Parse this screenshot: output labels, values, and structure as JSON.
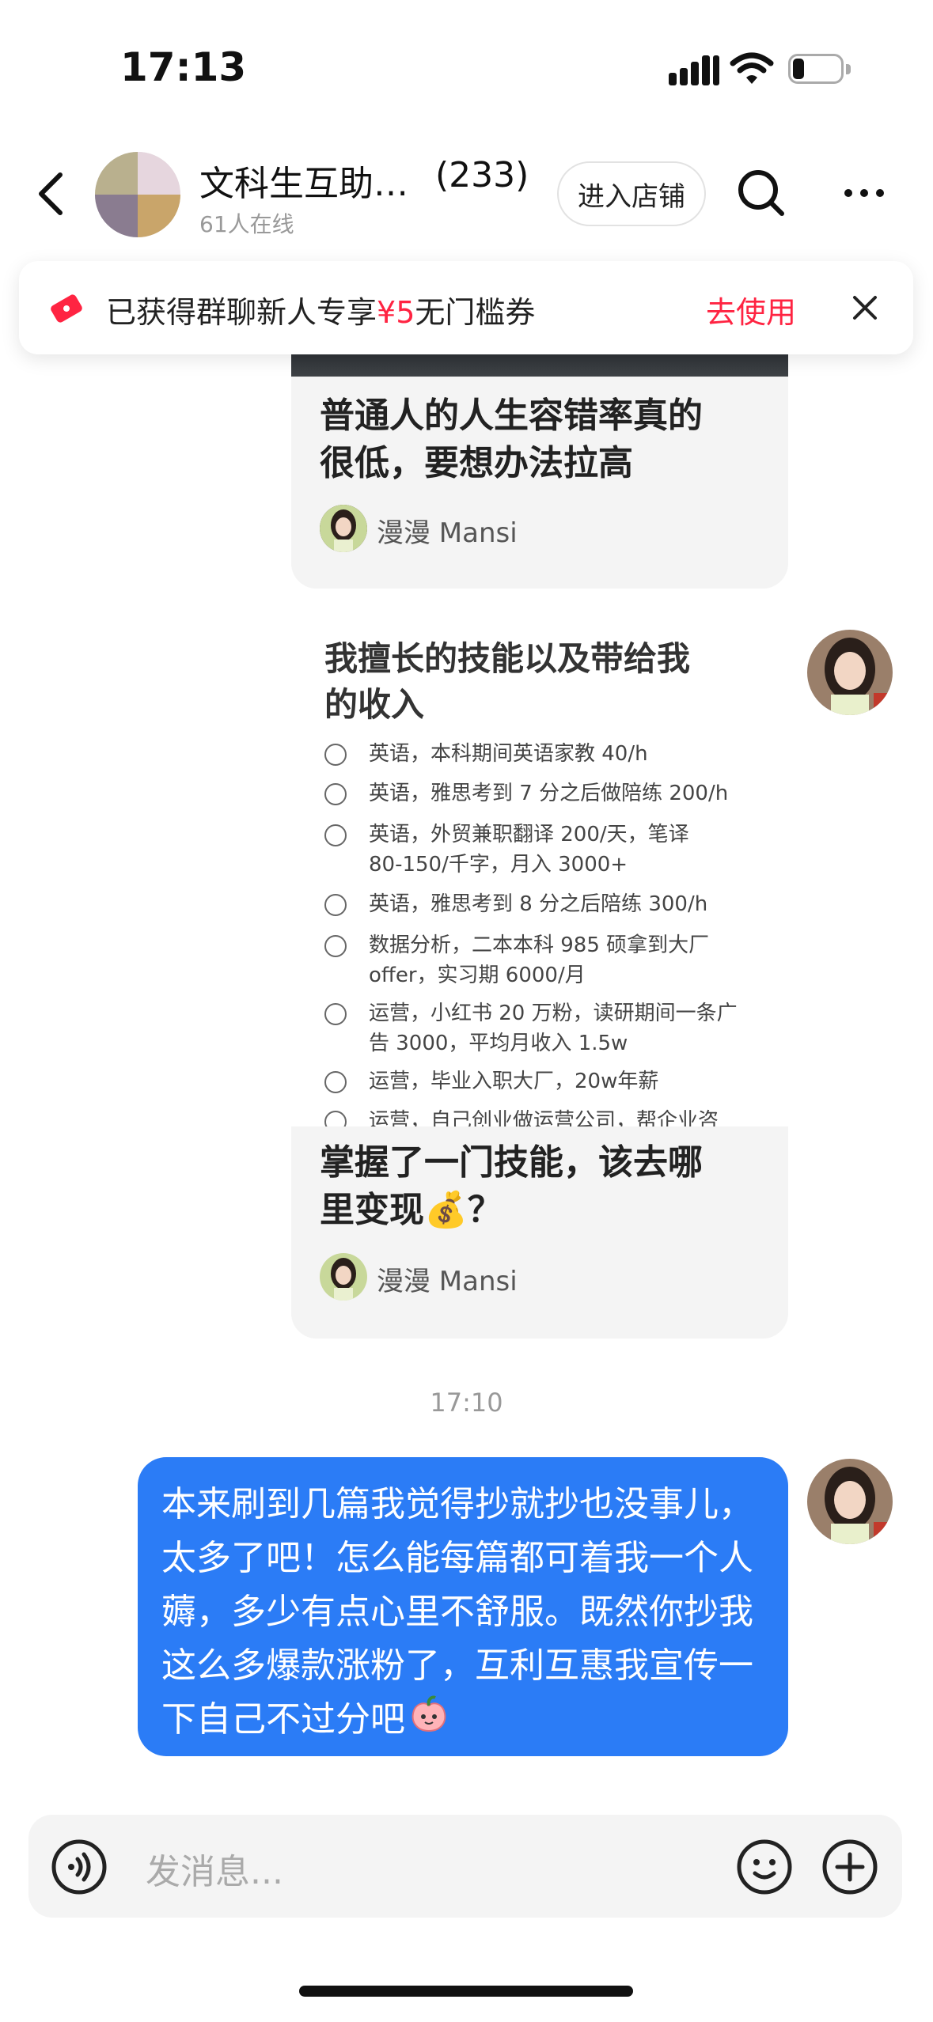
{
  "status_bar": {
    "time": "17:13"
  },
  "header": {
    "title": "文科生互助…",
    "member_count": "(233)",
    "online": "61人在线",
    "store_button": "进入店铺"
  },
  "coupon": {
    "text_prefix": "已获得群聊新人专享",
    "amount": "¥5",
    "text_suffix": "无门槛券",
    "action": "去使用"
  },
  "messages": {
    "card1": {
      "title_line1": "普通人的人生容错率真的",
      "title_line2": "很低，要想办法拉高",
      "author": "漫漫 Mansi"
    },
    "card2": {
      "image_title_line1": "我擅长的技能以及带给我",
      "image_title_line2": "的收入",
      "skills": [
        {
          "line1": "英语，本科期间英语家教 40/h",
          "line2": ""
        },
        {
          "line1": "英语，雅思考到 7 分之后做陪练 200/h",
          "line2": ""
        },
        {
          "line1": "英语，外贸兼职翻译 200/天，笔译",
          "line2": "80-150/千字，月入 3000+"
        },
        {
          "line1": "英语，雅思考到 8 分之后陪练 300/h",
          "line2": ""
        },
        {
          "line1": "数据分析，二本本科 985 硕拿到大厂",
          "line2": "offer，实习期 6000/月"
        },
        {
          "line1": "运营，小红书 20 万粉，读研期间一条广",
          "line2": "告 3000，平均月收入 1.5w"
        },
        {
          "line1": "运营，毕业入职大厂，20w年薪",
          "line2": ""
        },
        {
          "line1": "运营，自己创业做运营公司，帮企业咨",
          "line2": ""
        }
      ],
      "title_line1": "掌握了一门技能，该去哪",
      "title_line2": "里变现💰？",
      "author": "漫漫 Mansi"
    },
    "timestamp": "17:10",
    "bubble": {
      "text": "本来刷到几篇我觉得抄就抄也没事儿，太多了吧！怎么能每篇都可着我一个人薅，多少有点心里不舒服。既然你抄我这么多爆款涨粉了，互利互惠我宣传一下自己不过分吧",
      "emoji": "peach-face-emoji"
    }
  },
  "input": {
    "placeholder": "发消息..."
  },
  "colors": {
    "accent_red": "#ff2442",
    "bubble_blue": "#2b7cf6"
  }
}
